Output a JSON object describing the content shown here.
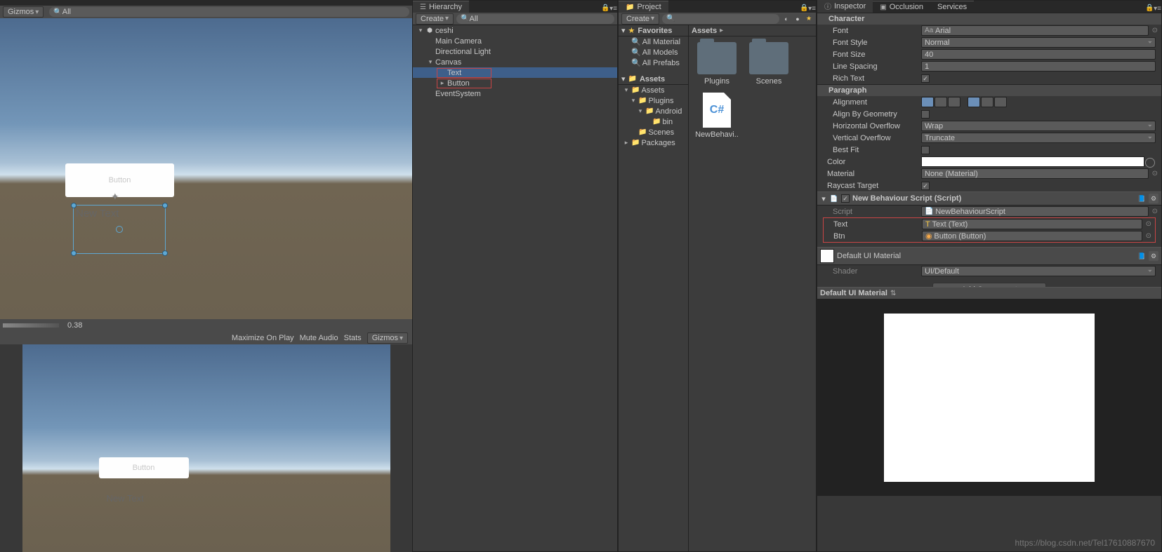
{
  "scene": {
    "gizmos": "Gizmos",
    "search": "All",
    "zoom": "0.38",
    "button_text": "Button",
    "text_label": "New Text"
  },
  "game": {
    "maximize": "Maximize On Play",
    "mute": "Mute Audio",
    "stats": "Stats",
    "gizmos": "Gizmos",
    "button_text": "Button",
    "text_label": "New Text"
  },
  "hierarchy": {
    "tab": "Hierarchy",
    "create": "Create",
    "search": "All",
    "items": [
      {
        "label": "ceshi",
        "indent": 0,
        "arrow": "▾",
        "icon": "unity"
      },
      {
        "label": "Main Camera",
        "indent": 1,
        "arrow": ""
      },
      {
        "label": "Directional Light",
        "indent": 1,
        "arrow": ""
      },
      {
        "label": "Canvas",
        "indent": 1,
        "arrow": "▾"
      },
      {
        "label": "Text",
        "indent": 2,
        "arrow": "",
        "sel": true,
        "red": true
      },
      {
        "label": "Button",
        "indent": 2,
        "arrow": "▸",
        "red": true
      },
      {
        "label": "EventSystem",
        "indent": 1,
        "arrow": ""
      }
    ]
  },
  "project": {
    "tab": "Project",
    "create": "Create",
    "favorites": "Favorites",
    "fav_items": [
      "All Material",
      "All Models",
      "All Prefabs"
    ],
    "assets": "Assets",
    "bread": "Assets",
    "tree": [
      {
        "label": "Assets",
        "indent": 0,
        "arrow": "▾"
      },
      {
        "label": "Plugins",
        "indent": 1,
        "arrow": "▾"
      },
      {
        "label": "Android",
        "indent": 2,
        "arrow": "▾"
      },
      {
        "label": "bin",
        "indent": 3,
        "arrow": ""
      },
      {
        "label": "Scenes",
        "indent": 1,
        "arrow": ""
      },
      {
        "label": "Packages",
        "indent": 0,
        "arrow": "▸"
      }
    ],
    "grid": [
      {
        "label": "Plugins",
        "type": "folder"
      },
      {
        "label": "Scenes",
        "type": "folder"
      },
      {
        "label": "NewBehavi..",
        "type": "script"
      }
    ]
  },
  "inspector": {
    "tabs": [
      "Inspector",
      "Occlusion",
      "Services"
    ],
    "character": {
      "header": "Character",
      "font": "Arial",
      "font_style": "Normal",
      "font_size": "40",
      "line_spacing": "1",
      "rich_text": true,
      "labels": {
        "font": "Font",
        "font_style": "Font Style",
        "font_size": "Font Size",
        "line_spacing": "Line Spacing",
        "rich_text": "Rich Text"
      }
    },
    "paragraph": {
      "header": "Paragraph",
      "labels": {
        "alignment": "Alignment",
        "align_geom": "Align By Geometry",
        "h_overflow": "Horizontal Overflow",
        "v_overflow": "Vertical Overflow",
        "best_fit": "Best Fit"
      },
      "h_overflow": "Wrap",
      "v_overflow": "Truncate"
    },
    "misc": {
      "color": "Color",
      "material": "Material",
      "material_val": "None (Material)",
      "raycast": "Raycast Target"
    },
    "script": {
      "header": "New Behaviour Script (Script)",
      "labels": {
        "script": "Script",
        "text": "Text",
        "btn": "Btn"
      },
      "script_val": "NewBehaviourScript",
      "text_val": "Text (Text)",
      "btn_val": "Button (Button)"
    },
    "material": {
      "header": "Default UI Material",
      "shader_label": "Shader",
      "shader_val": "UI/Default",
      "preview": "Default UI Material"
    },
    "add_component": "Add Component"
  },
  "watermark": "https://blog.csdn.net/Tel17610887670"
}
